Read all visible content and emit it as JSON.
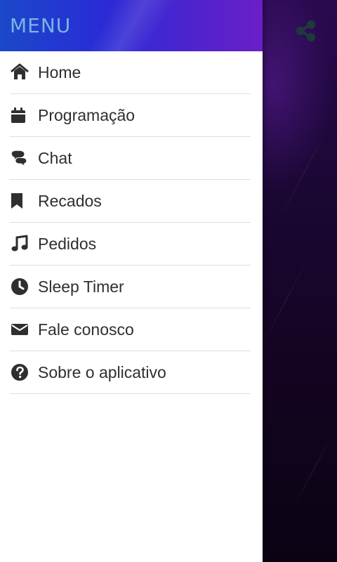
{
  "drawer": {
    "title": "MENU",
    "items": [
      {
        "label": "Home",
        "icon": "home-icon"
      },
      {
        "label": "Programação",
        "icon": "calendar-icon"
      },
      {
        "label": "Chat",
        "icon": "chat-icon"
      },
      {
        "label": "Recados",
        "icon": "bookmark-icon"
      },
      {
        "label": "Pedidos",
        "icon": "music-note-icon"
      },
      {
        "label": "Sleep Timer",
        "icon": "clock-icon"
      },
      {
        "label": "Fale conosco",
        "icon": "envelope-icon"
      },
      {
        "label": "Sobre o aplicativo",
        "icon": "question-circle-icon"
      }
    ]
  },
  "background": {
    "share_icon": "share-icon"
  },
  "colors": {
    "menu_title": "#79b5e6",
    "header_start": "#1b48c9",
    "header_end": "#6b1ec7",
    "item_text": "#2f2f2f",
    "divider": "#dedede",
    "background_dark": "#12041f",
    "share_icon": "#1f3a3a"
  }
}
